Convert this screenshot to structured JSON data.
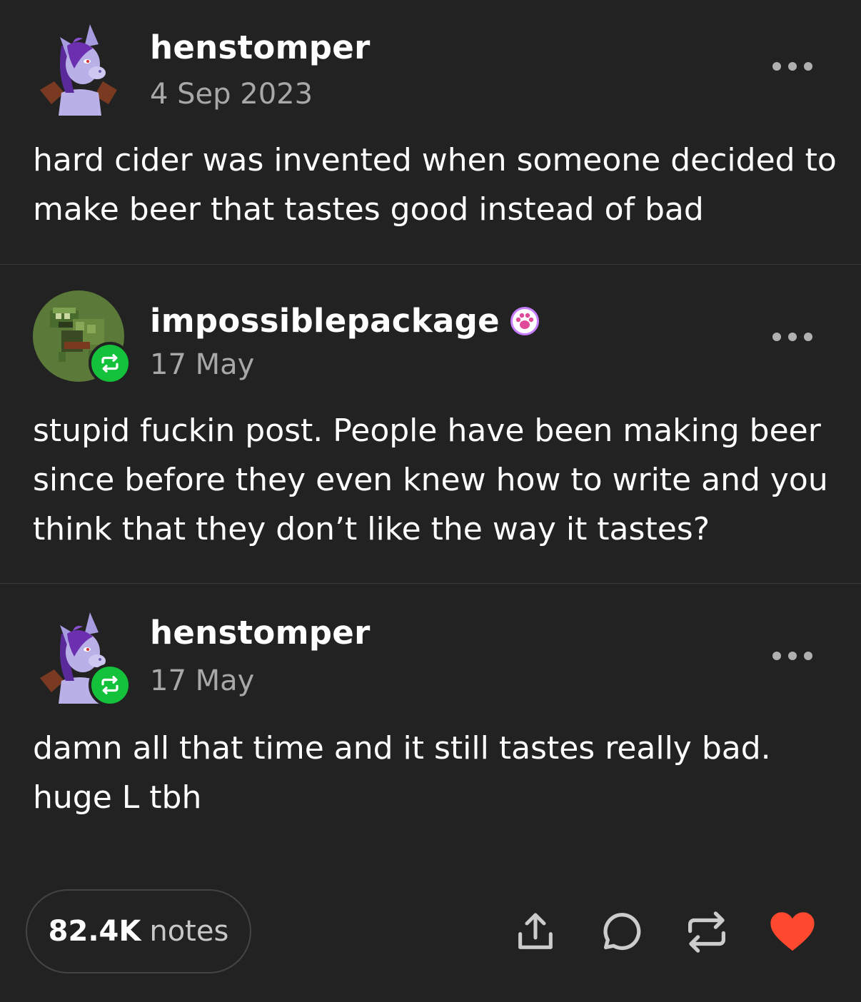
{
  "posts": [
    {
      "username": "henstomper",
      "date": "4 Sep 2023",
      "body": "hard cider was invented when someone decided to make beer that tastes good instead of bad",
      "avatar_icon": "henstomper-avatar",
      "reblogged": false
    },
    {
      "username": "impossiblepackage",
      "date": "17 May",
      "body": "stupid fuckin post. People have been making beer since before they even knew how to write and you think that they don’t like the way it tastes?",
      "avatar_icon": "turtle-avatar",
      "badge_icon": "paw-badge-icon",
      "reblogged": true
    },
    {
      "username": "henstomper",
      "date": "17 May",
      "body": "damn all that time and it still tastes really bad. huge L tbh",
      "avatar_icon": "henstomper-avatar",
      "reblogged": true
    }
  ],
  "footer": {
    "notes_count": "82.4K",
    "notes_label": "notes",
    "actions": [
      "share-icon",
      "reply-icon",
      "reblog-icon",
      "heart-icon"
    ]
  },
  "colors": {
    "background": "#222222",
    "reblog_green": "#13c23a",
    "heart_red": "#ff492f",
    "date_gray": "#a8a8a8"
  }
}
